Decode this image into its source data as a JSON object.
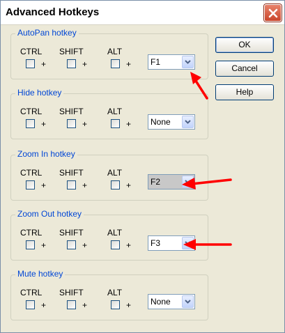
{
  "window": {
    "title": "Advanced Hotkeys"
  },
  "buttons": {
    "ok": "OK",
    "cancel": "Cancel",
    "help": "Help"
  },
  "modifiers": {
    "ctrl": "CTRL",
    "shift": "SHIFT",
    "alt": "ALT",
    "plus": "+"
  },
  "groups": [
    {
      "title": "AutoPan hotkey",
      "key": "F1"
    },
    {
      "title": "Hide hotkey",
      "key": "None"
    },
    {
      "title": "Zoom In hotkey",
      "key": "F2"
    },
    {
      "title": "Zoom Out hotkey",
      "key": "F3"
    },
    {
      "title": "Mute hotkey",
      "key": "None"
    }
  ],
  "colors": {
    "group_title": "#0046d5",
    "annotation_arrow": "#ff0000",
    "dialog_bg": "#ece9d8"
  }
}
